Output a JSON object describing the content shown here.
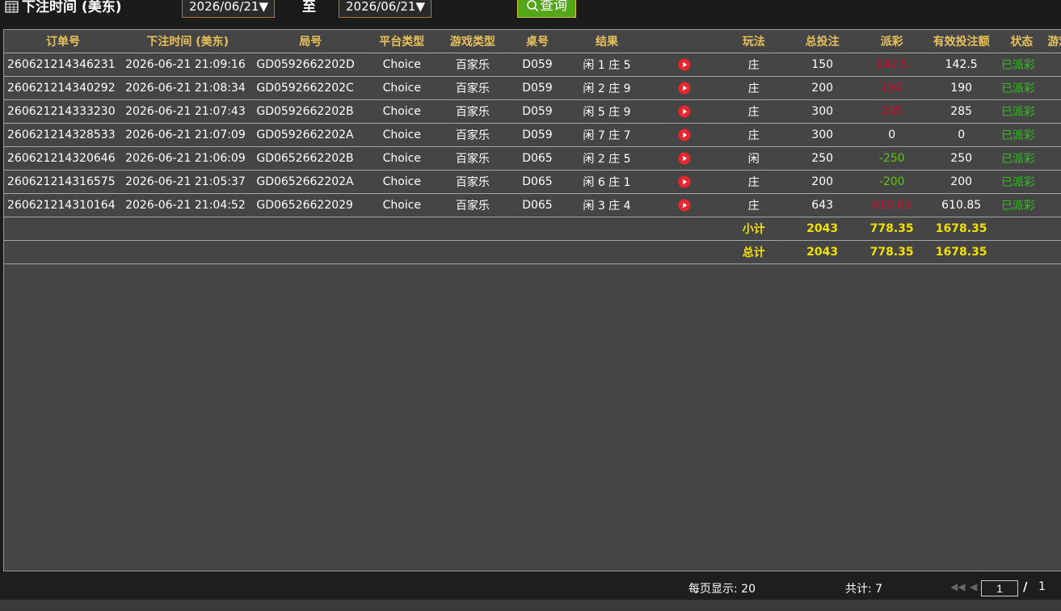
{
  "filter": {
    "title": "下注时间 (美东)",
    "date_from": "2026/06/21▼",
    "separator": "至",
    "date_to": "2026/06/21▼",
    "query_label": "查询"
  },
  "table": {
    "columns": [
      "订单号",
      "下注时间 (美东)",
      "局号",
      "平台类型",
      "游戏类型",
      "桌号",
      "结果",
      "",
      "玩法",
      "总投注",
      "派彩",
      "有效投注额",
      "状态",
      "游戏"
    ],
    "rows": [
      {
        "order": "260621214346231",
        "time": "2026-06-21 21:09:16",
        "round": "GD0592662202D",
        "platform": "Choice",
        "game": "百家乐",
        "table": "D059",
        "result": "闲 1 庄 5",
        "play": "庄",
        "bet": "150",
        "payout": "142.5",
        "payout_color": "red",
        "valid": "142.5",
        "status": "已派彩"
      },
      {
        "order": "260621214340292",
        "time": "2026-06-21 21:08:34",
        "round": "GD0592662202C",
        "platform": "Choice",
        "game": "百家乐",
        "table": "D059",
        "result": "闲 2 庄 9",
        "play": "庄",
        "bet": "200",
        "payout": "190",
        "payout_color": "red",
        "valid": "190",
        "status": "已派彩"
      },
      {
        "order": "260621214333230",
        "time": "2026-06-21 21:07:43",
        "round": "GD0592662202B",
        "platform": "Choice",
        "game": "百家乐",
        "table": "D059",
        "result": "闲 5 庄 9",
        "play": "庄",
        "bet": "300",
        "payout": "285",
        "payout_color": "red",
        "valid": "285",
        "status": "已派彩"
      },
      {
        "order": "260621214328533",
        "time": "2026-06-21 21:07:09",
        "round": "GD0592662202A",
        "platform": "Choice",
        "game": "百家乐",
        "table": "D059",
        "result": "闲 7 庄 7",
        "play": "庄",
        "bet": "300",
        "payout": "0",
        "payout_color": "white",
        "valid": "0",
        "status": "已派彩"
      },
      {
        "order": "260621214320646",
        "time": "2026-06-21 21:06:09",
        "round": "GD0652662202B",
        "platform": "Choice",
        "game": "百家乐",
        "table": "D065",
        "result": "闲 2 庄 5",
        "play": "闲",
        "bet": "250",
        "payout": "-250",
        "payout_color": "green",
        "valid": "250",
        "status": "已派彩"
      },
      {
        "order": "260621214316575",
        "time": "2026-06-21 21:05:37",
        "round": "GD0652662202A",
        "platform": "Choice",
        "game": "百家乐",
        "table": "D065",
        "result": "闲 6 庄 1",
        "play": "庄",
        "bet": "200",
        "payout": "-200",
        "payout_color": "green",
        "valid": "200",
        "status": "已派彩"
      },
      {
        "order": "260621214310164",
        "time": "2026-06-21 21:04:52",
        "round": "GD06526622029",
        "platform": "Choice",
        "game": "百家乐",
        "table": "D065",
        "result": "闲 3 庄 4",
        "play": "庄",
        "bet": "643",
        "payout": "610.85",
        "payout_color": "red",
        "valid": "610.85",
        "status": "已派彩"
      }
    ],
    "subtotal": {
      "label": "小计",
      "bet": "2043",
      "payout": "778.35",
      "valid": "1678.35"
    },
    "total": {
      "label": "总计",
      "bet": "2043",
      "payout": "778.35",
      "valid": "1678.35"
    }
  },
  "footer": {
    "page_size": "每页显示: 20",
    "total_count": "共计: 7",
    "current_page": "1",
    "slash": "/",
    "total_pages": "1"
  },
  "colors": {
    "header_text": "#e8c15b",
    "payout_red": "#c8102e",
    "payout_green": "#5ec40f",
    "status_green": "#2fc21c",
    "total_yellow": "#f2e000",
    "query_button": "#53a617"
  }
}
